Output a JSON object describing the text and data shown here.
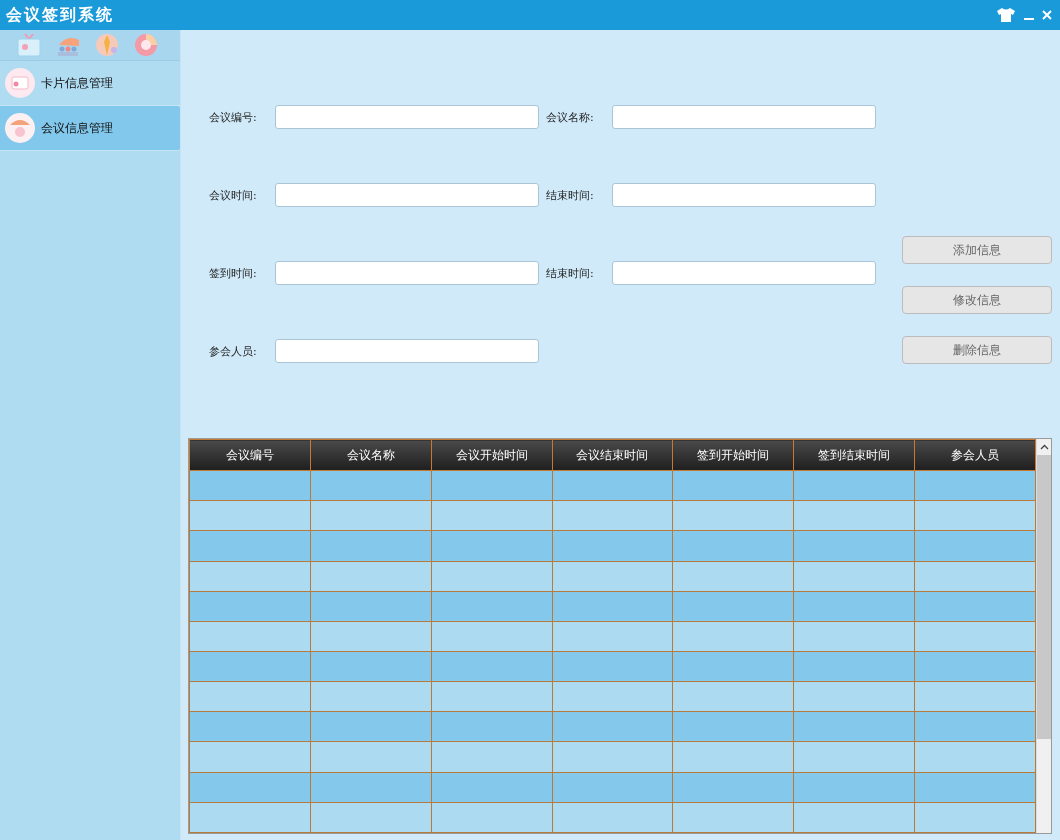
{
  "window": {
    "title": "会议签到系统"
  },
  "sidebar": {
    "items": [
      {
        "label": "卡片信息管理",
        "selected": false
      },
      {
        "label": "会议信息管理",
        "selected": true
      }
    ]
  },
  "form": {
    "rows": [
      [
        {
          "label": "会议编号:"
        },
        {
          "label": "会议名称:"
        }
      ],
      [
        {
          "label": "会议时间:"
        },
        {
          "label": "结束时间:"
        }
      ],
      [
        {
          "label": "签到时间:"
        },
        {
          "label": "结束时间:"
        }
      ],
      [
        {
          "label": "参会人员:"
        }
      ]
    ],
    "buttons": [
      {
        "label": "添加信息"
      },
      {
        "label": "修改信息"
      },
      {
        "label": "删除信息"
      }
    ]
  },
  "table": {
    "columns": [
      "会议编号",
      "会议名称",
      "会议开始时间",
      "会议结束时间",
      "签到开始时间",
      "签到结束时间",
      "参会人员"
    ],
    "rows": [
      {
        "selected": false
      },
      {
        "selected": false
      },
      {
        "selected": false
      },
      {
        "selected": false
      },
      {
        "selected": false
      },
      {
        "selected": false
      },
      {
        "selected": false
      },
      {
        "selected": false
      },
      {
        "selected": false
      },
      {
        "selected": false
      },
      {
        "selected": false
      },
      {
        "selected": false
      }
    ]
  }
}
